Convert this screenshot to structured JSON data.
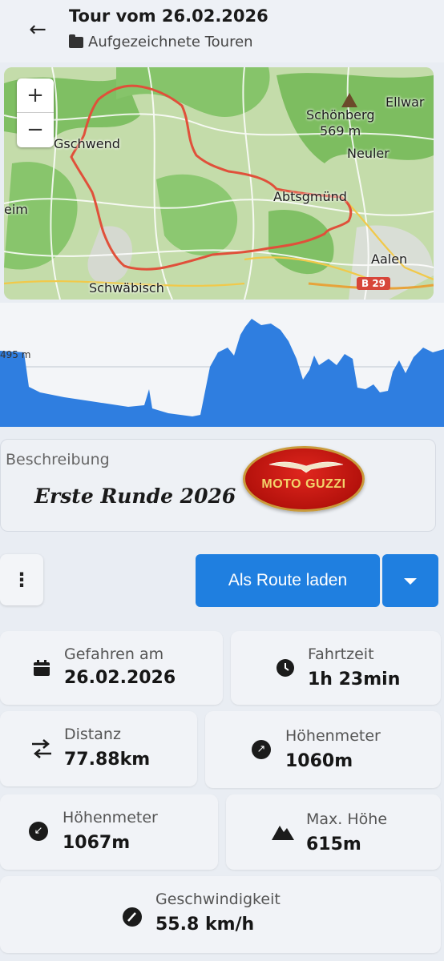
{
  "header": {
    "title": "Tour vom 26.02.2026",
    "subtitle": "Aufgezeichnete Touren",
    "back_icon": "arrow-left-icon",
    "folder_icon": "folder-icon"
  },
  "map": {
    "zoom_in": "+",
    "zoom_out": "−",
    "labels": {
      "gschwend": "Gschwend",
      "schoenberg": "Schönberg",
      "schoenberg_height": "569 m",
      "ellwangen": "Ellwar",
      "neuler": "Neuler",
      "abtsgmuend": "Abtsgmünd",
      "aalen": "Aalen",
      "heim": "eim",
      "schwaebisch": "Schwäbisch",
      "b29": "B 29"
    },
    "route_color": "#e0503a"
  },
  "elevation": {
    "label": "495 m",
    "fill_color": "#2f7ee0"
  },
  "description": {
    "label": "Beschreibung",
    "text": "Erste Runde 2026",
    "logo_text": "MOTO GUZZI"
  },
  "actions": {
    "more_label": "⋮",
    "route_button": "Als Route laden",
    "dropdown_icon": "caret-down-icon"
  },
  "stats": {
    "driven_on": {
      "label": "Gefahren am",
      "value": "26.02.2026",
      "icon": "calendar-icon"
    },
    "duration": {
      "label": "Fahrtzeit",
      "value": "1h 23min",
      "icon": "clock-icon"
    },
    "distance": {
      "label": "Distanz",
      "value": "77.88km",
      "icon": "swap-arrows-icon"
    },
    "ascent": {
      "label": "Höhenmeter",
      "value": "1060m",
      "icon": "arrow-up-right-icon"
    },
    "descent": {
      "label": "Höhenmeter",
      "value": "1067m",
      "icon": "arrow-down-left-icon"
    },
    "max_height": {
      "label": "Max. Höhe",
      "value": "615m",
      "icon": "mountain-icon"
    },
    "speed": {
      "label": "Geschwindigkeit",
      "value": "55.8 km/h",
      "icon": "speedometer-icon"
    }
  },
  "colors": {
    "accent": "#1f7fe0",
    "card": "#f1f3f7"
  }
}
